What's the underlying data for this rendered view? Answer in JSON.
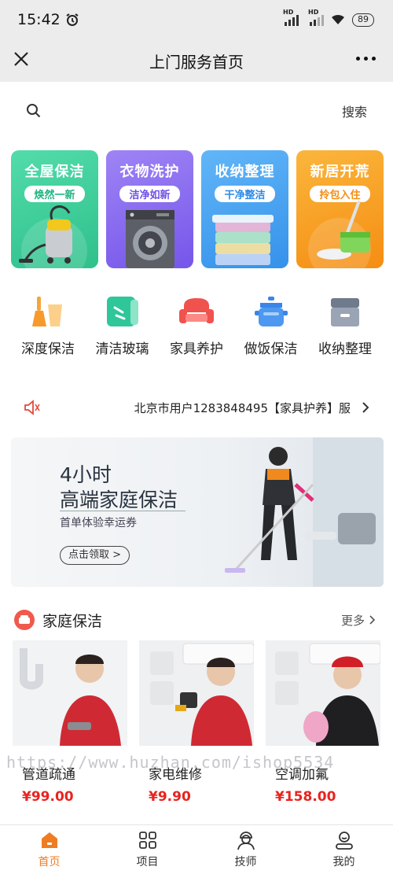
{
  "status": {
    "time": "15:42",
    "hd1": "HD",
    "hd2": "HD",
    "battery": "89"
  },
  "nav": {
    "title": "上门服务首页"
  },
  "search": {
    "label": "搜索"
  },
  "cards": [
    {
      "title": "全屋保洁",
      "subtitle": "焕然一新",
      "bg": "#3ecf9a",
      "accent": "#1fb580"
    },
    {
      "title": "衣物洗护",
      "subtitle": "洁净如新",
      "bg": "#8b6cf0",
      "accent": "#6f4fe6"
    },
    {
      "title": "收纳整理",
      "subtitle": "干净整洁",
      "bg": "#49a6f5",
      "accent": "#2d8ae8"
    },
    {
      "title": "新居开荒",
      "subtitle": "拎包入住",
      "bg": "#f7a62a",
      "accent": "#f58d13"
    }
  ],
  "categories": [
    {
      "label": "深度保洁",
      "icon": "broom-icon"
    },
    {
      "label": "清洁玻璃",
      "icon": "glass-cleaning-icon"
    },
    {
      "label": "家具养护",
      "icon": "sofa-icon"
    },
    {
      "label": "做饭保洁",
      "icon": "cooking-pot-icon"
    },
    {
      "label": "收纳整理",
      "icon": "storage-box-icon"
    }
  ],
  "notice": {
    "text": "北京市用户1283848495【家具护养】服"
  },
  "banner": {
    "line1": "4小时",
    "line2": "高端家庭保洁",
    "line3": "首单体验幸运券",
    "button": "点击领取 >"
  },
  "section": {
    "title": "家庭保洁",
    "more": "更多"
  },
  "products": [
    {
      "name": "管道疏通",
      "price": "¥99.00"
    },
    {
      "name": "家电维修",
      "price": "¥9.90"
    },
    {
      "name": "空调加氟",
      "price": "¥158.00"
    }
  ],
  "watermark": "https://www.huzhan.com/ishop5534",
  "tabs": [
    {
      "label": "首页",
      "icon": "home-icon",
      "active": true
    },
    {
      "label": "项目",
      "icon": "grid-icon",
      "active": false
    },
    {
      "label": "技师",
      "icon": "technician-icon",
      "active": false
    },
    {
      "label": "我的",
      "icon": "profile-icon",
      "active": false
    }
  ],
  "colors": {
    "accent": "#f07c22",
    "price": "#e8231f",
    "navBg": "#ececec"
  }
}
